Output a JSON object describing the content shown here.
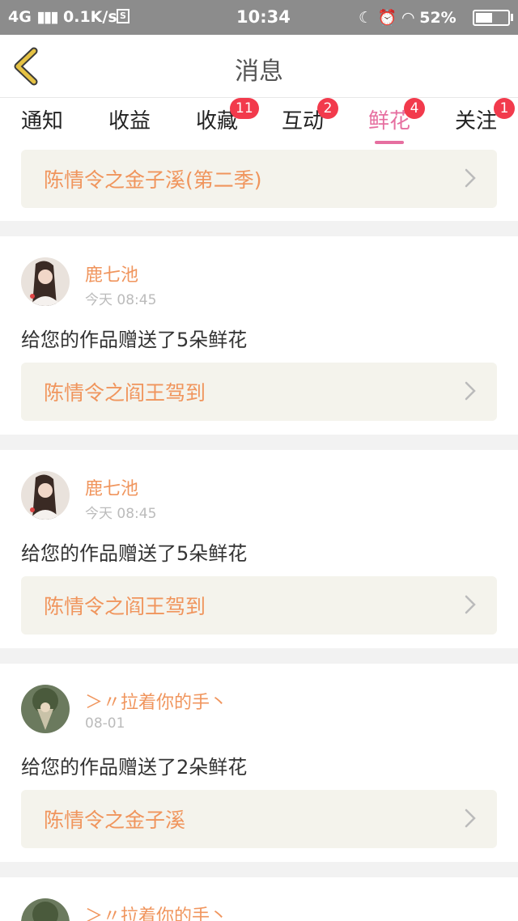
{
  "statusbar": {
    "network": "4G",
    "speed": "0.1K/s",
    "s_icon": "S",
    "time": "10:34",
    "battery": "52%",
    "battery_level": 0.52
  },
  "header": {
    "title": "消息",
    "back_icon": "chevron-left-icon"
  },
  "tabs": [
    {
      "label": "通知",
      "badge": ""
    },
    {
      "label": "收益",
      "badge": ""
    },
    {
      "label": "收藏",
      "badge": "11"
    },
    {
      "label": "互动",
      "badge": "2"
    },
    {
      "label": "鲜花",
      "badge": "4",
      "active": true
    },
    {
      "label": "关注",
      "badge": "1"
    }
  ],
  "top_work": {
    "title": "陈情令之金子溪(第二季)"
  },
  "messages": [
    {
      "user": "鹿七池",
      "time": "今天 08:45",
      "text": "给您的作品赠送了5朵鲜花",
      "work": "陈情令之阎王驾到"
    },
    {
      "user": "鹿七池",
      "time": "今天 08:45",
      "text": "给您的作品赠送了5朵鲜花",
      "work": "陈情令之阎王驾到"
    },
    {
      "user": "＞〃拉着你的手丶",
      "time": "08-01",
      "text": "给您的作品赠送了2朵鲜花",
      "work": "陈情令之金子溪"
    },
    {
      "user": "＞〃拉着你的手丶",
      "time": "",
      "text": "",
      "work": ""
    }
  ],
  "colors": {
    "accent": "#f0955d",
    "active_tab": "#e66fa0",
    "badge": "#f23a4c",
    "back_icon": "#e5c244"
  }
}
